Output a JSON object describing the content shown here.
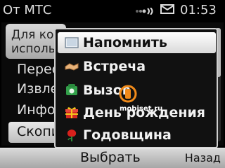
{
  "status": {
    "operator": "От МТС",
    "time": "01:53"
  },
  "background": {
    "note_lines": [
      "Для кор",
      "исполь"
    ],
    "items": [
      "Перес",
      "Извле",
      "Инфо",
      "Скопи"
    ]
  },
  "popup": {
    "items": [
      {
        "label": "Напомнить",
        "icon": "memo-icon"
      },
      {
        "label": "Встреча",
        "icon": "handshake-icon"
      },
      {
        "label": "Вызов",
        "icon": "phone-icon"
      },
      {
        "label": "День рождения",
        "icon": "gift-icon"
      },
      {
        "label": "Годовщина",
        "icon": "rose-icon"
      }
    ]
  },
  "softkeys": {
    "select": "Выбрать",
    "back": "Назад"
  },
  "watermark": "mobiset.ru"
}
